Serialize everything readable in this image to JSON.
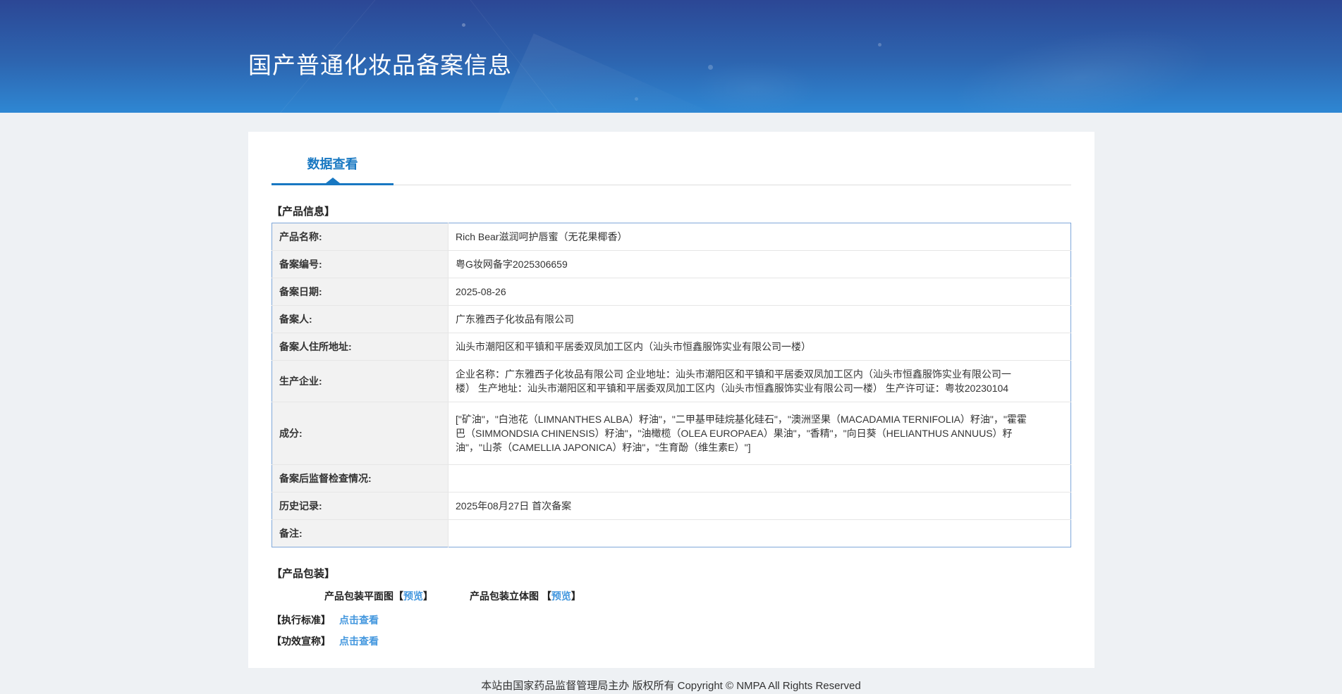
{
  "banner": {
    "title": "国产普通化妆品备案信息"
  },
  "tabs": {
    "data_view": "数据查看"
  },
  "sections": {
    "product_info": "【产品信息】",
    "packaging": "【产品包装】",
    "standard": "【执行标准】",
    "efficacy": "【功效宣称】"
  },
  "table": {
    "rows": [
      {
        "label": "产品名称:",
        "value": "Rich Bear滋润呵护唇蜜（无花果椰香）"
      },
      {
        "label": "备案编号:",
        "value": "粤G妆网备字2025306659"
      },
      {
        "label": "备案日期:",
        "value": "2025-08-26"
      },
      {
        "label": "备案人:",
        "value": "广东雅西子化妆品有限公司"
      },
      {
        "label": "备案人住所地址:",
        "value": "汕头市潮阳区和平镇和平居委双凤加工区内（汕头市恒鑫服饰实业有限公司一楼）"
      },
      {
        "label": "生产企业:",
        "value": "企业名称：广东雅西子化妆品有限公司 企业地址：汕头市潮阳区和平镇和平居委双凤加工区内（汕头市恒鑫服饰实业有限公司一楼） 生产地址：汕头市潮阳区和平镇和平居委双凤加工区内（汕头市恒鑫服饰实业有限公司一楼） 生产许可证：粤妆20230104"
      },
      {
        "label": "成分:",
        "value": "[\"矿油\"，\"白池花（LIMNANTHES ALBA）籽油\"，\"二甲基甲硅烷基化硅石\"，\"澳洲坚果（MACADAMIA TERNIFOLIA）籽油\"，\"霍霍巴（SIMMONDSIA CHINENSIS）籽油\"，\"油橄榄（OLEA EUROPAEA）果油\"，\"香精\"，\"向日葵（HELIANTHUS ANNUUS）籽油\"，\"山茶（CAMELLIA JAPONICA）籽油\"，\"生育酚（维生素E）\"]"
      },
      {
        "label": "备案后监督检查情况:",
        "value": ""
      },
      {
        "label": "历史记录:",
        "value": "2025年08月27日 首次备案"
      },
      {
        "label": "备注:",
        "value": ""
      }
    ]
  },
  "packaging": {
    "flat_prefix": "产品包装平面图【",
    "stereo_prefix": "产品包装立体图 【",
    "preview": "预览",
    "bracket_close": "】"
  },
  "actions": {
    "view_details": "点击查看"
  },
  "footer": {
    "text": "本站由国家药品监督管理局主办 版权所有 Copyright © NMPA All Rights Reserved"
  },
  "colors": {
    "banner_gradient_top": "#2c4795",
    "banner_gradient_bottom": "#2e87d3",
    "tab_active": "#1878c2",
    "link": "#4397de",
    "table_border": "#7fa7d9",
    "label_cell_bg": "#f2f2f2",
    "page_bg": "#eef1f4"
  }
}
